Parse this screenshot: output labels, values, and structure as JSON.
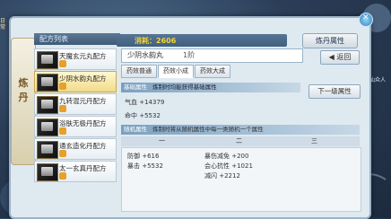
{
  "header": {
    "list_title": "配方列表",
    "cost_label": "消耗：2606",
    "refine_button": "炼丹属性"
  },
  "side_tab": {
    "label": "炼丹"
  },
  "recipes": [
    {
      "name": "天魔玄元丸配方",
      "selected": false
    },
    {
      "name": "少阴水韵丸配方",
      "selected": true
    },
    {
      "name": "九转混元丹配方",
      "selected": false
    },
    {
      "name": "浴肤无极丹配方",
      "selected": false
    },
    {
      "name": "通玄造化丹配方",
      "selected": false
    },
    {
      "name": "太一玄真丹配方",
      "selected": false
    }
  ],
  "detail": {
    "item_name": "少阴水韵丸",
    "level": "1阶",
    "back_button": "返回",
    "tabs": [
      "药效普通",
      "药效小成",
      "药效大成"
    ],
    "base_section": {
      "tag": "基础属性",
      "desc": "炼制时均能获得基础属性"
    },
    "base_stats": [
      "气血 +14379",
      "命中 +5532"
    ],
    "next_button": "下一级属性",
    "random_section": {
      "tag": "随机属性",
      "desc": "炼制时将从随机属性中每一类随机一个属性"
    },
    "columns": [
      "一",
      "二",
      "三"
    ],
    "col1": [
      "防御 +616",
      "暴击 +5532"
    ],
    "col2": [
      "暴伤减免 +200",
      "会心抗性 +1021",
      "减闪 +2212"
    ]
  },
  "side": {
    "left_label": "日常",
    "right_label": "聚仙众人"
  }
}
